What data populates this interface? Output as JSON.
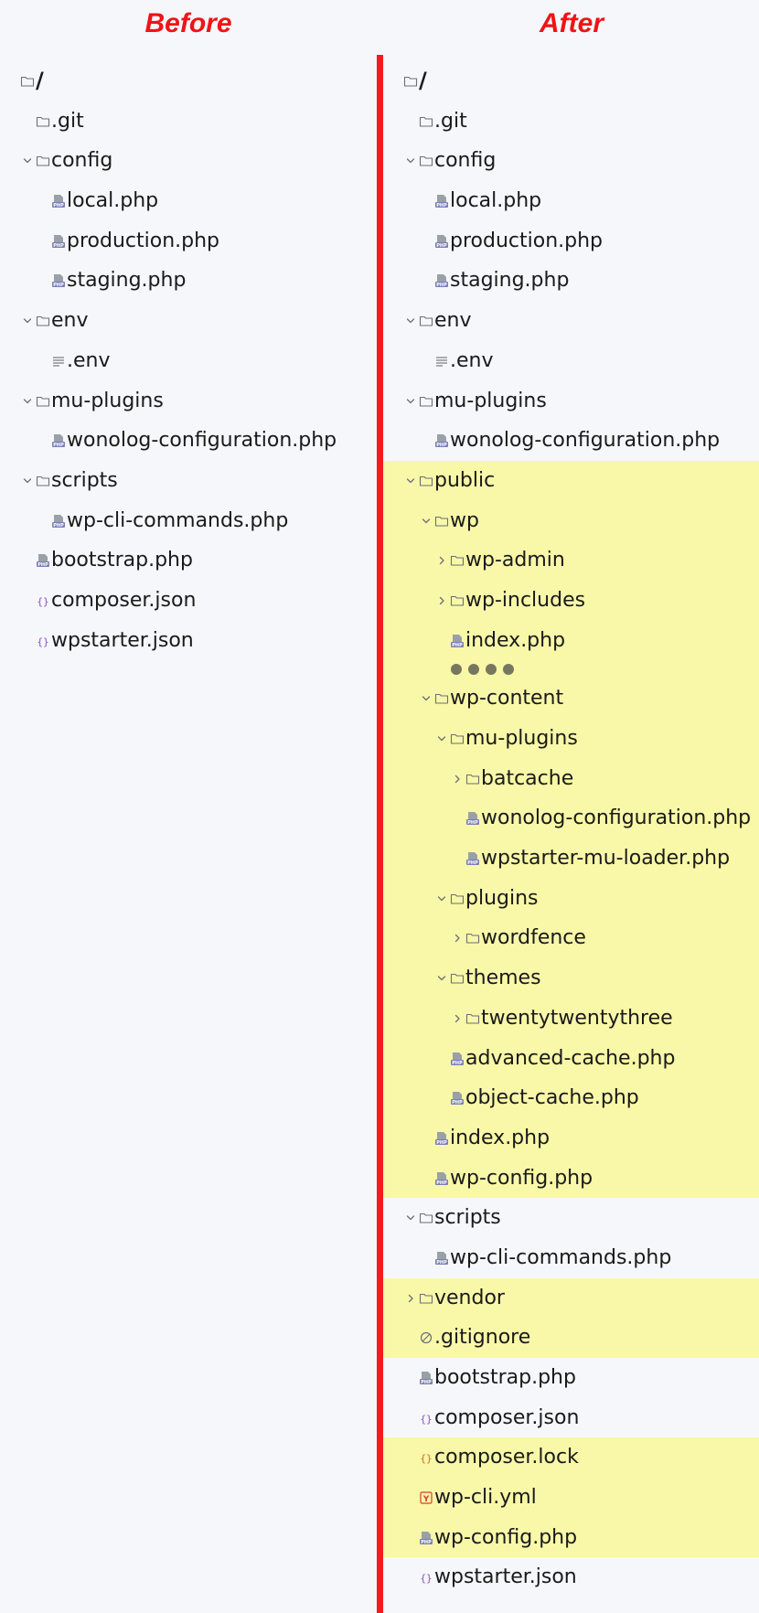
{
  "headings": {
    "before": "Before",
    "after": "After"
  },
  "colors": {
    "accent": "#f51a1e",
    "highlight": "#f8f8a8",
    "background": "#f6f7fa"
  },
  "before": [
    {
      "label": "/",
      "icon": "folder-icon",
      "depth": 0,
      "root": true
    },
    {
      "label": ".git",
      "icon": "folder-icon",
      "depth": 1
    },
    {
      "label": "config",
      "icon": "folder-icon",
      "depth": 1,
      "chevron": "down"
    },
    {
      "label": "local.php",
      "icon": "php-file-icon",
      "depth": 2
    },
    {
      "label": "production.php",
      "icon": "php-file-icon",
      "depth": 2
    },
    {
      "label": "staging.php",
      "icon": "php-file-icon",
      "depth": 2
    },
    {
      "label": "env",
      "icon": "folder-icon",
      "depth": 1,
      "chevron": "down"
    },
    {
      "label": ".env",
      "icon": "text-file-icon",
      "depth": 2
    },
    {
      "label": "mu-plugins",
      "icon": "folder-icon",
      "depth": 1,
      "chevron": "down"
    },
    {
      "label": "wonolog-configuration.php",
      "icon": "php-file-icon",
      "depth": 2
    },
    {
      "label": "scripts",
      "icon": "folder-icon",
      "depth": 1,
      "chevron": "down"
    },
    {
      "label": "wp-cli-commands.php",
      "icon": "php-file-icon",
      "depth": 2
    },
    {
      "label": "bootstrap.php",
      "icon": "php-file-icon",
      "depth": 1
    },
    {
      "label": "composer.json",
      "icon": "json-file-icon",
      "depth": 1
    },
    {
      "label": "wpstarter.json",
      "icon": "json-file-icon",
      "depth": 1
    }
  ],
  "after": [
    {
      "label": "/",
      "icon": "folder-icon",
      "depth": 0,
      "root": true
    },
    {
      "label": ".git",
      "icon": "folder-icon",
      "depth": 1
    },
    {
      "label": "config",
      "icon": "folder-icon",
      "depth": 1,
      "chevron": "down"
    },
    {
      "label": "local.php",
      "icon": "php-file-icon",
      "depth": 2
    },
    {
      "label": "production.php",
      "icon": "php-file-icon",
      "depth": 2
    },
    {
      "label": "staging.php",
      "icon": "php-file-icon",
      "depth": 2
    },
    {
      "label": "env",
      "icon": "folder-icon",
      "depth": 1,
      "chevron": "down"
    },
    {
      "label": ".env",
      "icon": "text-file-icon",
      "depth": 2
    },
    {
      "label": "mu-plugins",
      "icon": "folder-icon",
      "depth": 1,
      "chevron": "down"
    },
    {
      "label": "wonolog-configuration.php",
      "icon": "php-file-icon",
      "depth": 2
    },
    {
      "label": "public",
      "icon": "folder-icon",
      "depth": 1,
      "chevron": "down",
      "highlight": true
    },
    {
      "label": "wp",
      "icon": "folder-icon",
      "depth": 2,
      "chevron": "down",
      "highlight": true
    },
    {
      "label": "wp-admin",
      "icon": "folder-icon",
      "depth": 3,
      "chevron": "right",
      "highlight": true
    },
    {
      "label": "wp-includes",
      "icon": "folder-icon",
      "depth": 3,
      "chevron": "right",
      "highlight": true
    },
    {
      "label": "index.php",
      "icon": "php-file-icon",
      "depth": 3,
      "highlight": true
    },
    {
      "dots": true,
      "depth": 3,
      "highlight": true
    },
    {
      "label": "wp-content",
      "icon": "folder-icon",
      "depth": 2,
      "chevron": "down",
      "highlight": true
    },
    {
      "label": "mu-plugins",
      "icon": "folder-icon",
      "depth": 3,
      "chevron": "down",
      "highlight": true
    },
    {
      "label": "batcache",
      "icon": "folder-icon",
      "depth": 4,
      "chevron": "right",
      "highlight": true
    },
    {
      "label": "wonolog-configuration.php",
      "icon": "php-file-icon",
      "depth": 4,
      "highlight": true
    },
    {
      "label": "wpstarter-mu-loader.php",
      "icon": "php-file-icon",
      "depth": 4,
      "highlight": true
    },
    {
      "label": "plugins",
      "icon": "folder-icon",
      "depth": 3,
      "chevron": "down",
      "highlight": true
    },
    {
      "label": "wordfence",
      "icon": "folder-icon",
      "depth": 4,
      "chevron": "right",
      "highlight": true
    },
    {
      "label": "themes",
      "icon": "folder-icon",
      "depth": 3,
      "chevron": "down",
      "highlight": true
    },
    {
      "label": "twentytwentythree",
      "icon": "folder-icon",
      "depth": 4,
      "chevron": "right",
      "highlight": true
    },
    {
      "label": "advanced-cache.php",
      "icon": "php-file-icon",
      "depth": 3,
      "highlight": true
    },
    {
      "label": "object-cache.php",
      "icon": "php-file-icon",
      "depth": 3,
      "highlight": true
    },
    {
      "label": "index.php",
      "icon": "php-file-icon",
      "depth": 2,
      "highlight": true
    },
    {
      "label": "wp-config.php",
      "icon": "php-file-icon",
      "depth": 2,
      "highlight": true
    },
    {
      "label": "scripts",
      "icon": "folder-icon",
      "depth": 1,
      "chevron": "down"
    },
    {
      "label": "wp-cli-commands.php",
      "icon": "php-file-icon",
      "depth": 2
    },
    {
      "label": "vendor",
      "icon": "folder-icon",
      "depth": 1,
      "chevron": "right",
      "highlight": true
    },
    {
      "label": ".gitignore",
      "icon": "gitignore-icon",
      "depth": 1,
      "highlight": true
    },
    {
      "label": "bootstrap.php",
      "icon": "php-file-icon",
      "depth": 1
    },
    {
      "label": "composer.json",
      "icon": "json-file-icon",
      "depth": 1
    },
    {
      "label": "composer.lock",
      "icon": "lock-file-icon",
      "depth": 1,
      "highlight": true
    },
    {
      "label": "wp-cli.yml",
      "icon": "yaml-file-icon",
      "depth": 1,
      "highlight": true
    },
    {
      "label": "wp-config.php",
      "icon": "php-file-icon",
      "depth": 1,
      "highlight": true
    },
    {
      "label": "wpstarter.json",
      "icon": "json-file-icon",
      "depth": 1
    }
  ]
}
